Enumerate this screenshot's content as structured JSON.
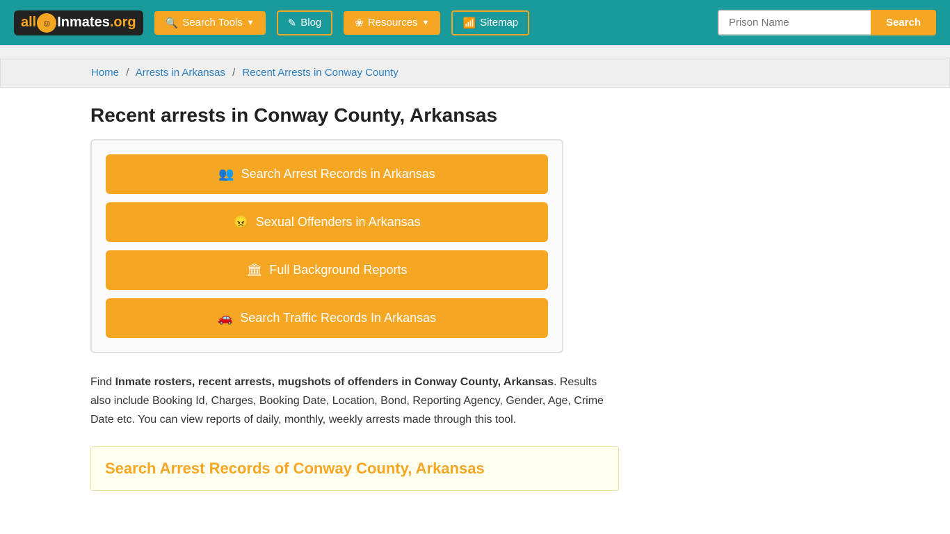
{
  "site": {
    "logo_all": "all",
    "logo_inmates": "Inmates",
    "logo_org": ".org",
    "logo_icon": "☺"
  },
  "header": {
    "nav": [
      {
        "label": "Search Tools",
        "has_dropdown": true,
        "icon": "🔍"
      },
      {
        "label": "Blog",
        "has_dropdown": false,
        "icon": "✎"
      },
      {
        "label": "Resources",
        "has_dropdown": true,
        "icon": "❀"
      },
      {
        "label": "Sitemap",
        "has_dropdown": false,
        "icon": "📶"
      }
    ],
    "search_placeholder": "Prison Name",
    "search_button": "Search"
  },
  "breadcrumb": {
    "home": "Home",
    "arrests": "Arrests in Arkansas",
    "current": "Recent Arrests in Conway County"
  },
  "page": {
    "title": "Recent arrests in Conway County, Arkansas"
  },
  "action_buttons": [
    {
      "label": "Search Arrest Records in Arkansas",
      "icon": "👥"
    },
    {
      "label": "Sexual Offenders in Arkansas",
      "icon": "😠"
    },
    {
      "label": "Full Background Reports",
      "icon": "🏛"
    },
    {
      "label": "Search Traffic Records In Arkansas",
      "icon": "🚗"
    }
  ],
  "description": {
    "intro": "Find ",
    "bold_text": "Inmate rosters, recent arrests, mugshots of offenders in Conway County, Arkansas",
    "rest": ". Results also include Booking Id, Charges, Booking Date, Location, Bond, Reporting Agency, Gender, Age, Crime Date etc. You can view reports of daily, monthly, weekly arrests made through this tool."
  },
  "arrest_section": {
    "title": "Search Arrest Records of Conway County, Arkansas"
  }
}
